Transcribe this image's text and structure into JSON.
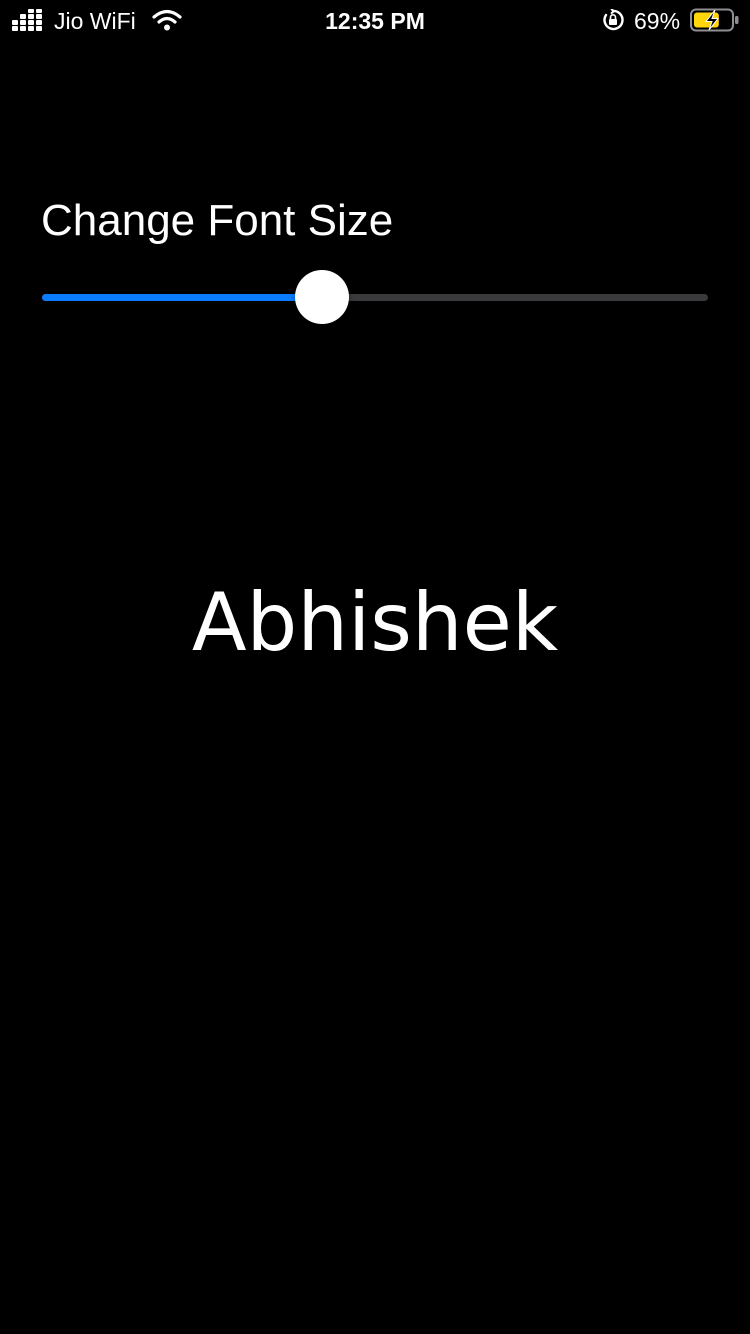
{
  "status_bar": {
    "carrier": "Jio WiFi",
    "time": "12:35 PM",
    "battery_percent": "69%",
    "icons": {
      "signal": "signal-bars-icon",
      "wifi": "wifi-icon",
      "rotation_lock": "rotation-lock-icon",
      "battery": "battery-charging-icon"
    },
    "battery_level": 0.69
  },
  "main": {
    "title": "Change Font Size",
    "slider": {
      "value": 0.42
    },
    "preview_text": "Abhishek"
  },
  "colors": {
    "background": "#000000",
    "text": "#ffffff",
    "slider_accent": "#0a7cff",
    "battery_charging": "#ffd60a"
  }
}
